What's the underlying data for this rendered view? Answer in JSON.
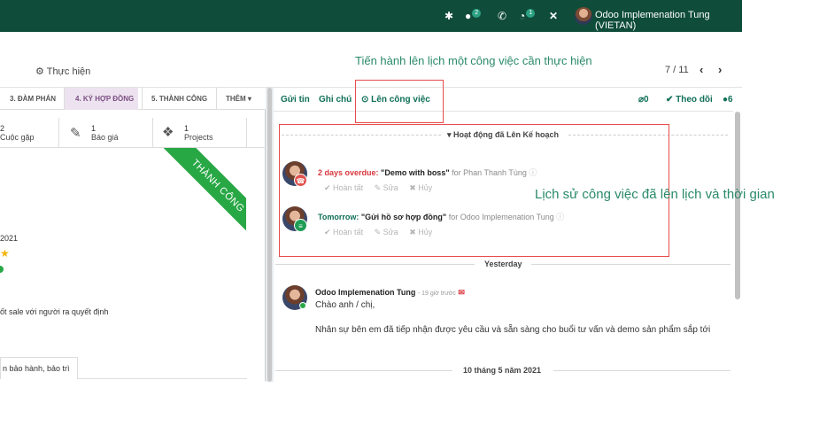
{
  "topbar": {
    "bug_icon": "bug-icon",
    "chat_icon": "chat-icon",
    "chat_count": "2",
    "phone_icon": "phone-icon",
    "clock_icon": "clock-icon",
    "clock_count": "1",
    "tools_icon": "tools-icon",
    "user_name": "Odoo Implemenation Tung (VIETAN)"
  },
  "subbar": {
    "action_label": "⚙ Thực hiện",
    "pager": "7 / 11",
    "prev": "‹",
    "next": "›"
  },
  "annotations": {
    "top": "Tiến hành lên lịch một công việc cần thực hiện",
    "side": "Lịch sử công việc đã lên lịch và thời gian"
  },
  "stages": [
    {
      "label": "3. ĐÀM PHÁN"
    },
    {
      "label": "4. KÝ HỢP ĐỒNG"
    },
    {
      "label": "5. THÀNH CÔNG"
    },
    {
      "label": "THÊM ▾"
    }
  ],
  "smart_buttons": [
    {
      "count": "2",
      "label": "Cuộc gặp"
    },
    {
      "count": "1",
      "label": "Báo giá"
    },
    {
      "count": "1",
      "label": "Projects"
    }
  ],
  "ribbon": "THÀNH CÔNG",
  "left_texts": {
    "year": "2021",
    "note": "ốt sale với người ra quyết định",
    "tab": "n bảo hành, bảo trì"
  },
  "chatter": {
    "send_message": "Gửi tin",
    "log_note": "Ghi chú",
    "schedule_activity": "⊙ Lên công việc",
    "attachments": "0",
    "follow": "✔ Theo dõi",
    "followers": "6",
    "planned_header": "▾ Hoạt động đã Lên Kế hoạch",
    "activities": [
      {
        "status": "2 days overdue:",
        "summary": "\"Demo with boss\"",
        "for": "for Phan Thanh Tùng",
        "type_color": "#e0544f",
        "actions": [
          "✔ Hoàn tất",
          "✎ Sửa",
          "✖ Hủy"
        ]
      },
      {
        "status": "Tomorrow:",
        "summary": "\"Gửi hồ sơ hợp đồng\"",
        "for": "for Odoo Implemenation Tung",
        "type_color": "#1f9d55",
        "actions": [
          "✔ Hoàn tất",
          "✎ Sửa",
          "✖ Hủy"
        ]
      }
    ],
    "date_yesterday": "Yesterday",
    "message": {
      "author": "Odoo Implemenation Tung",
      "time": "- 19 giờ trước",
      "greeting": "Chào anh / chị,",
      "body": "Nhân sự bên em đã tiếp nhận được yêu cầu và sẵn sàng cho buổi tư vấn và demo sản phẩm sắp tới"
    },
    "date_older": "10 tháng 5 năm 2021"
  }
}
